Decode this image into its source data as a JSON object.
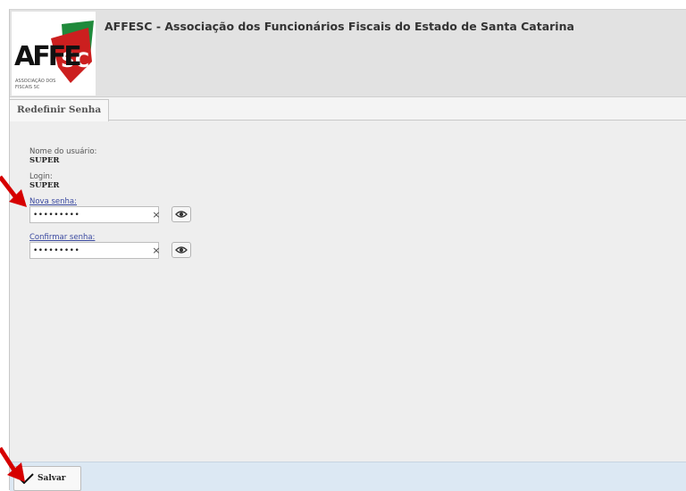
{
  "header": {
    "title": "AFFESC - Associação dos Funcionários Fiscais do Estado de Santa Catarina",
    "logo_text": "AFFESC",
    "logo_tagline": "ASSOCIAÇÃO DOS FUNCIONÁRIOS FISCAIS"
  },
  "tabs": [
    {
      "label": "Redefinir Senha",
      "active": true
    }
  ],
  "form": {
    "username_label": "Nome do usuário:",
    "username_value": "SUPER",
    "login_label": "Login:",
    "login_value": "SUPER",
    "new_password_label": "Nova senha:",
    "new_password_value": "•••••••••",
    "confirm_password_label": "Confirmar senha:",
    "confirm_password_value": "•••••••••",
    "clear_glyph": "×"
  },
  "footer": {
    "save_label": "Salvar"
  },
  "colors": {
    "arrow_red": "#d60000",
    "logo_green": "#1f8a3b",
    "logo_red": "#cc1f1f",
    "link_blue": "#3b4aa0",
    "footer_bg": "#dce8f3"
  },
  "icons": [
    "affesc-logo",
    "clear-icon",
    "eye-icon",
    "checkmark-icon",
    "red-arrow-annotation"
  ]
}
